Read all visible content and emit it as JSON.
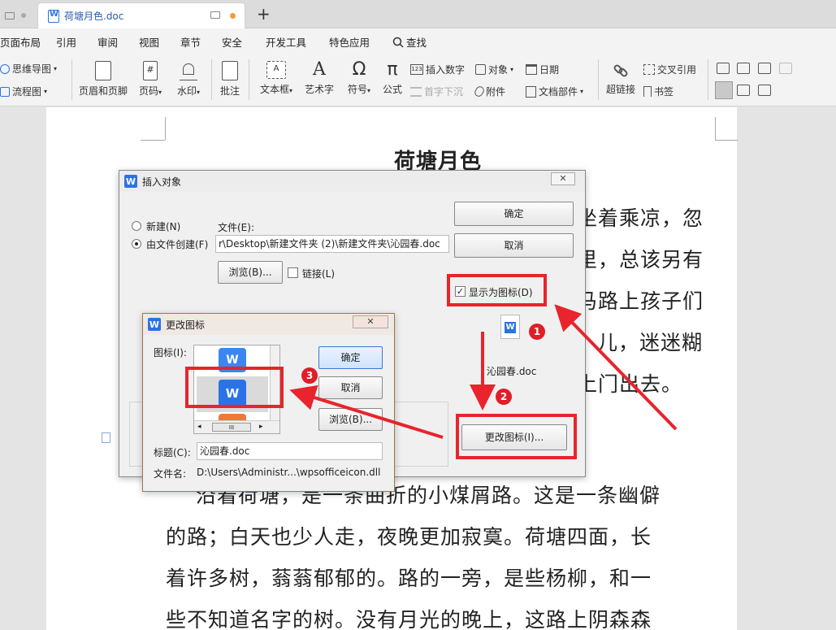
{
  "tabbar": {
    "doc_tab_title": "荷塘月色.doc",
    "new_tab_symbol": "+"
  },
  "menu": [
    "页面布局",
    "引用",
    "审阅",
    "视图",
    "章节",
    "安全",
    "开发工具",
    "特色应用"
  ],
  "search_label": "查找",
  "ribbon": {
    "mindmap": "思维导图",
    "flowchart": "流程图",
    "header_footer": "页眉和页脚",
    "page_number": "页码",
    "watermark": "水印",
    "comment": "批注",
    "textbox": "文本框",
    "wordart": "艺术字",
    "symbol": "符号",
    "formula": "公式",
    "insert_number": "插入数字",
    "object": "对象",
    "date": "日期",
    "drop_cap": "首字下沉",
    "attachment": "附件",
    "doc_parts": "文档部件",
    "hyperlink": "超链接",
    "cross_ref": "交叉引用",
    "bookmark": "书签"
  },
  "document": {
    "title": "荷塘月色",
    "lines_right": [
      "坐着乘凉，忽",
      "里，总该另有",
      "马路上孩子们",
      "儿，迷迷糊",
      "上门出去。"
    ],
    "lines_bottom": [
      "沿着荷塘，是一条曲折的小煤屑路。这是一条幽僻",
      "的路；白天也少人走，夜晚更加寂寞。荷塘四面，长",
      "着许多树，蓊蓊郁郁的。路的一旁，是些杨柳，和一",
      "些不知道名字的树。没有月光的晚上，这路上阴森森"
    ]
  },
  "insert_object_dialog": {
    "title": "插入对象",
    "radio_new": "新建(N)",
    "radio_from_file": "由文件创建(F)",
    "file_label": "文件(E):",
    "file_path": "r\\Desktop\\新建文件夹 (2)\\新建文件夹\\沁园春.doc",
    "browse": "浏览(B)...",
    "link": "链接(L)",
    "ok": "确定",
    "cancel": "取消",
    "show_as_icon": "显示为图标(D)",
    "icon_caption": "沁园春.doc",
    "change_icon": "更改图标(I)..."
  },
  "change_icon_dialog": {
    "title": "更改图标",
    "icon_label": "图标(I):",
    "ok": "确定",
    "cancel": "取消",
    "browse": "浏览(B)...",
    "caption_label": "标题(C):",
    "caption_value": "沁园春.doc",
    "filename_label": "文件名:",
    "filename_value": "D:\\Users\\Administr...\\wpsofficeicon.dll",
    "scroll_thumb": "III"
  },
  "annotations": {
    "step1": "1",
    "step2": "2",
    "step3": "3",
    "color": "#e8242c"
  }
}
